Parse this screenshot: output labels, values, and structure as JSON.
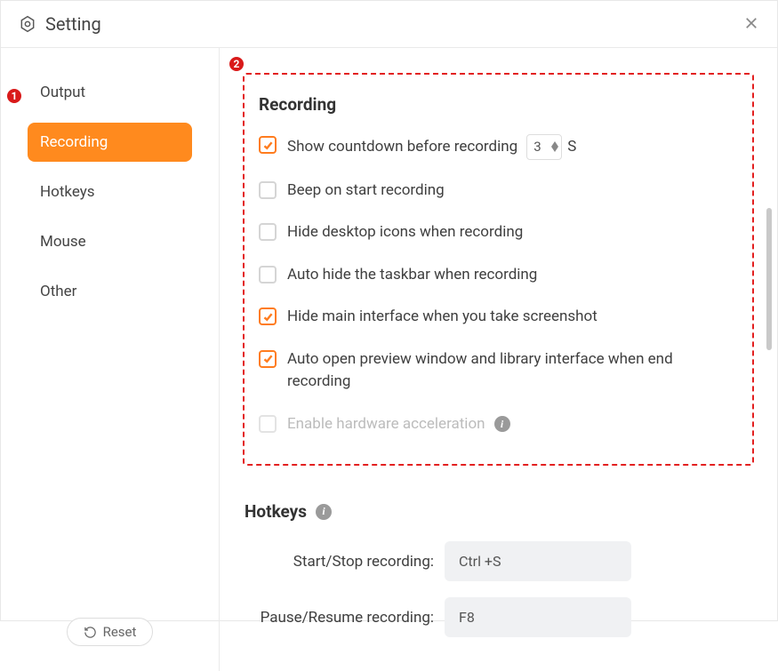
{
  "window": {
    "title": "Setting"
  },
  "sidebar": {
    "items": [
      {
        "label": "Output"
      },
      {
        "label": "Recording"
      },
      {
        "label": "Hotkeys"
      },
      {
        "label": "Mouse"
      },
      {
        "label": "Other"
      }
    ],
    "active_index": 1,
    "reset_label": "Reset"
  },
  "recording_section": {
    "title": "Recording",
    "options": [
      {
        "label": "Show countdown before recording",
        "checked": true,
        "has_number": true,
        "number_value": "3",
        "number_unit": "S"
      },
      {
        "label": "Beep on start recording",
        "checked": false
      },
      {
        "label": "Hide desktop icons when recording",
        "checked": false
      },
      {
        "label": "Auto hide the taskbar when recording",
        "checked": false
      },
      {
        "label": "Hide main interface when you take screenshot",
        "checked": true
      },
      {
        "label": "Auto open preview window and library interface when end recording",
        "checked": true
      },
      {
        "label": "Enable hardware acceleration",
        "checked": false,
        "disabled": true,
        "has_info": true
      }
    ]
  },
  "hotkeys_section": {
    "title": "Hotkeys",
    "rows": [
      {
        "label": "Start/Stop recording:",
        "value": "Ctrl +S"
      },
      {
        "label": "Pause/Resume recording:",
        "value": "F8"
      }
    ]
  },
  "annotations": {
    "badge1": "1",
    "badge2": "2"
  }
}
